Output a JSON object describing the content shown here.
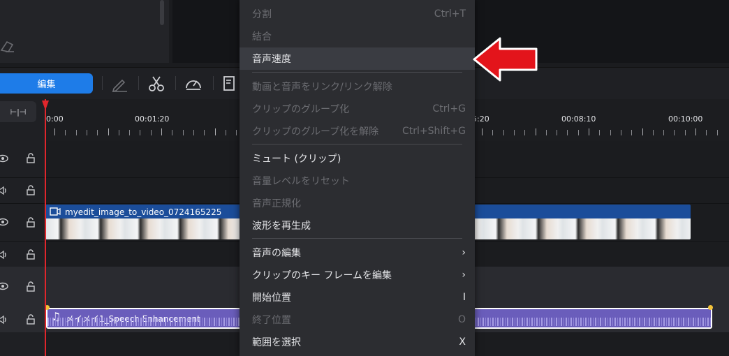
{
  "toolbar": {
    "edit_tab": "編集"
  },
  "timeline": {
    "time_zero": "0:00",
    "ruler": [
      "00:01:20",
      "5:20",
      "00:08:10",
      "00:10:00"
    ]
  },
  "video_clip": {
    "title": "myedit_image_to_video_0724165225"
  },
  "audio_clip": {
    "title": "メイメイ1_Speech Enhancement"
  },
  "menu": {
    "items": [
      {
        "label": "分割",
        "shortcut": "Ctrl+T"
      },
      {
        "label": "結合",
        "shortcut": ""
      },
      {
        "label": "音声速度",
        "shortcut": ""
      },
      {
        "label": "動画と音声をリンク/リンク解除",
        "shortcut": ""
      },
      {
        "label": "クリップのグループ化",
        "shortcut": "Ctrl+G"
      },
      {
        "label": "クリップのグループ化を解除",
        "shortcut": "Ctrl+Shift+G"
      },
      {
        "label": "ミュート (クリップ)",
        "shortcut": ""
      },
      {
        "label": "音量レベルをリセット",
        "shortcut": ""
      },
      {
        "label": "音声正規化",
        "shortcut": ""
      },
      {
        "label": "波形を再生成",
        "shortcut": ""
      },
      {
        "label": "音声の編集",
        "shortcut": "›"
      },
      {
        "label": "クリップのキー フレームを編集",
        "shortcut": "›"
      },
      {
        "label": "開始位置",
        "shortcut": "I"
      },
      {
        "label": "終了位置",
        "shortcut": "O"
      },
      {
        "label": "範囲を選択",
        "shortcut": "X"
      }
    ]
  },
  "colors": {
    "accent": "#1e7ce8",
    "playhead": "#e0262c",
    "arrow": "#e3141b",
    "audio_clip": "#6a5dbb",
    "video_clip": "#1b4d9a"
  }
}
